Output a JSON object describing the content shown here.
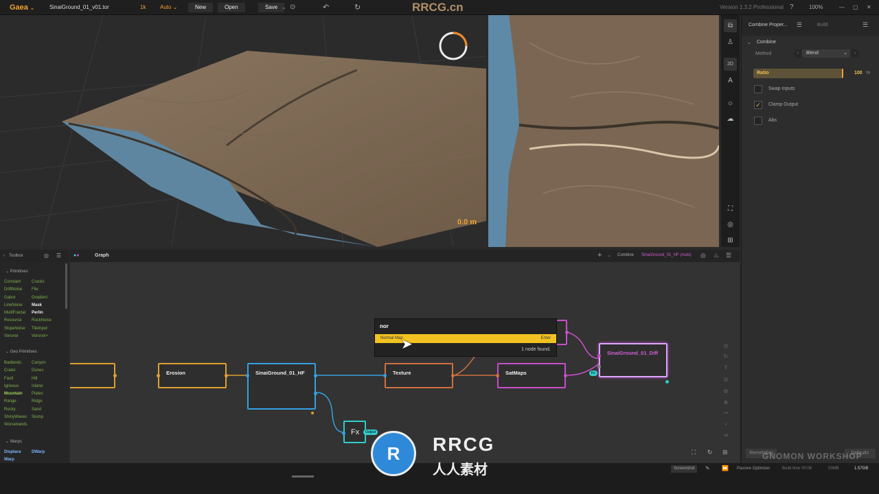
{
  "app": {
    "name": "Gaea",
    "file": "SinaiGround_01_v01.tor",
    "resolution": "1k",
    "mode": "Auto",
    "version": "Version 1.3.2 Professional",
    "zoom": "100%"
  },
  "toolbar": {
    "new_label": "New",
    "open_label": "Open",
    "save_label": "Save"
  },
  "viewport": {
    "distance": "0.0 m",
    "view2d_label": "2D"
  },
  "properties": {
    "tab_active": "Combine Proper...",
    "tab_inactive": "Build",
    "section": "Combine",
    "method_label": "Method",
    "method_value": "Blend",
    "ratio_label": "Ratio",
    "ratio_value": "100",
    "ratio_unit": "%",
    "ratio_fraction": 1.0,
    "checkboxes": [
      {
        "label": "Swap Inputs",
        "checked": false
      },
      {
        "label": "Clamp Output",
        "checked": true
      },
      {
        "label": "Abs",
        "checked": false
      }
    ],
    "remember_label": "Remember",
    "defaults_label": "Defaults"
  },
  "toolbox": {
    "title": "Toolbox",
    "sections": [
      {
        "name": "Primitives",
        "items": [
          [
            "Constant",
            "Cracks"
          ],
          [
            "DriftNoise",
            "File"
          ],
          [
            "Gabor",
            "Gradient"
          ],
          [
            "LineNoise",
            "Mask"
          ],
          [
            "MultiFractal",
            "Perlin"
          ],
          [
            "Resource",
            "RockNoise"
          ],
          [
            "SlopeNoise",
            "TileInput"
          ],
          [
            "Voronoi",
            "Voronoi+"
          ]
        ]
      },
      {
        "name": "Geo Primitives",
        "items": [
          [
            "Badlands",
            "Canyon"
          ],
          [
            "Crater",
            "Dunes"
          ],
          [
            "Fault",
            "Hill"
          ],
          [
            "Igneous",
            "Island"
          ],
          [
            "Mountain",
            "Plates"
          ],
          [
            "Range",
            "Ridge"
          ],
          [
            "Rocky",
            "Sand"
          ],
          [
            "ShinyWaves",
            "Slump"
          ],
          [
            "Worsebands",
            ""
          ]
        ]
      },
      {
        "name": "Warps",
        "items": [
          [
            "Displace",
            "DWarp"
          ],
          [
            "Warp",
            ""
          ]
        ]
      }
    ]
  },
  "graph": {
    "tab": "Graph",
    "breadcrumb_node": "Combine",
    "breadcrumb_target": "SinaiGround_01_HF (Auto)",
    "nodes": {
      "erosion": "Erosion",
      "hf": "SinaiGround_01_HF",
      "texture": "Texture",
      "satmaps": "SatMaps",
      "diff": "SinaiGround_01_Diff",
      "fx": "Fx",
      "fx_badge": "Output",
      "diff_badge": "Fx"
    },
    "search": {
      "query": "nor",
      "result": "Normal Map",
      "hint": "Enter",
      "status": "1 node found."
    }
  },
  "status": {
    "screenshot": "Screenshot",
    "optimizer": "Passive Optimizer",
    "build_time": "Build time 00:06",
    "memory": "00MB",
    "size": "1.57GB"
  },
  "watermark": {
    "top": "RRCG.cn",
    "brand": "RRCG",
    "brand_cn": "人人素材",
    "corner": "GNOMON WORKSHOP"
  }
}
